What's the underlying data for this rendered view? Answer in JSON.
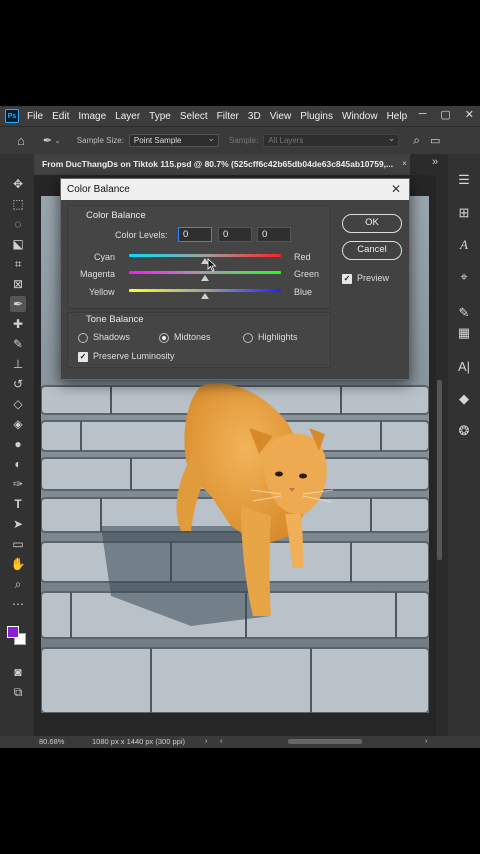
{
  "menu": {
    "items": [
      "File",
      "Edit",
      "Image",
      "Layer",
      "Type",
      "Select",
      "Filter",
      "3D",
      "View",
      "Plugins",
      "Window",
      "Help"
    ],
    "logo": "Ps"
  },
  "options": {
    "sample_size_label": "Sample Size:",
    "sample_size_value": "Point Sample",
    "sample_label": "Sample:",
    "sample_value": "All Layers"
  },
  "document": {
    "tab_title": "From DucThangDs on Tiktok 115.psd @ 80.7% (525cff6c42b65db04de63c845ab10759,...",
    "close": "×"
  },
  "status": {
    "zoom": "80.68%",
    "dimensions": "1080 px x 1440 px (300 ppi)"
  },
  "dialog": {
    "title": "Color Balance",
    "close": "✕",
    "group_title": "Color Balance",
    "color_levels_label": "Color Levels:",
    "levels": [
      "0",
      "0",
      "0"
    ],
    "sliders": [
      {
        "left": "Cyan",
        "right": "Red",
        "value": 0
      },
      {
        "left": "Magenta",
        "right": "Green",
        "value": 0
      },
      {
        "left": "Yellow",
        "right": "Blue",
        "value": 0
      }
    ],
    "tone_title": "Tone Balance",
    "tones": [
      "Shadows",
      "Midtones",
      "Highlights"
    ],
    "selected_tone": "Midtones",
    "preserve_label": "Preserve Luminosity",
    "preserve_checked": true,
    "ok": "OK",
    "cancel": "Cancel",
    "preview_label": "Preview",
    "preview_checked": true
  },
  "colors": {
    "foreground": "#8a1fd6",
    "background": "#ffffff",
    "accent": "#2b86ff"
  }
}
